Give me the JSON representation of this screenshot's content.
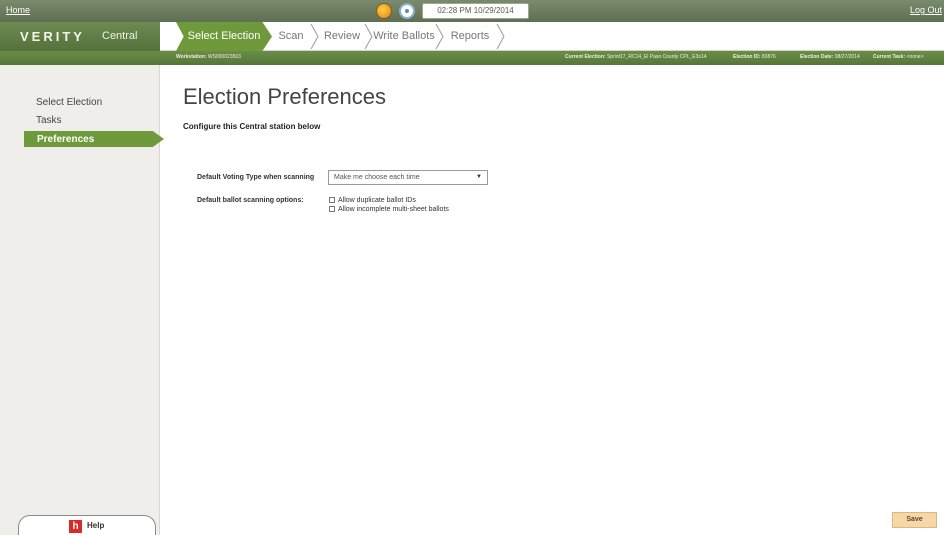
{
  "topbar": {
    "home_label": "Home",
    "logout_label": "Log Out",
    "status_icon_a": "warning-status-icon",
    "status_icon_b": "connection-status-icon",
    "clock": "02:28 PM 10/29/2014"
  },
  "brand": {
    "product": "VERITY",
    "station": "Central"
  },
  "steps": [
    {
      "label": "Select Election",
      "active": true
    },
    {
      "label": "Scan",
      "active": false
    },
    {
      "label": "Review",
      "active": false
    },
    {
      "label": "Write Ballots",
      "active": false
    },
    {
      "label": "Reports",
      "active": false
    }
  ],
  "infostrip": {
    "workstation_label": "Workstation:",
    "workstation_value": "WS000023503",
    "election_label": "Current Election:",
    "election_value": "Sprint17_RC14_El Paso County CPL_E3s14",
    "election_id_label": "Election ID:",
    "election_id_value": "83876",
    "election_date_label": "Election Date:",
    "election_date_value": "08/27/2014",
    "task_label": "Current Task:",
    "task_value": "<none>"
  },
  "sidebar": {
    "items": [
      {
        "label": "Select Election"
      },
      {
        "label": "Tasks"
      },
      {
        "label": "Preferences",
        "active": true
      }
    ],
    "help_label": "Help",
    "help_icon_glyph": "h"
  },
  "main": {
    "title": "Election Preferences",
    "subtitle": "Configure this Central station below",
    "voting_type_label": "Default Voting Type when scanning",
    "voting_type_value": "Make me choose each time",
    "scan_options_label": "Default ballot scanning options:",
    "options": [
      {
        "label": "Allow duplicate ballot IDs",
        "checked": false
      },
      {
        "label": "Allow incomplete multi-sheet ballots",
        "checked": false
      }
    ],
    "save_label": "Save"
  },
  "colors": {
    "accent_green": "#6f9a3c",
    "topbar": "#6b7b5e",
    "save_button": "#f6d7a8"
  }
}
